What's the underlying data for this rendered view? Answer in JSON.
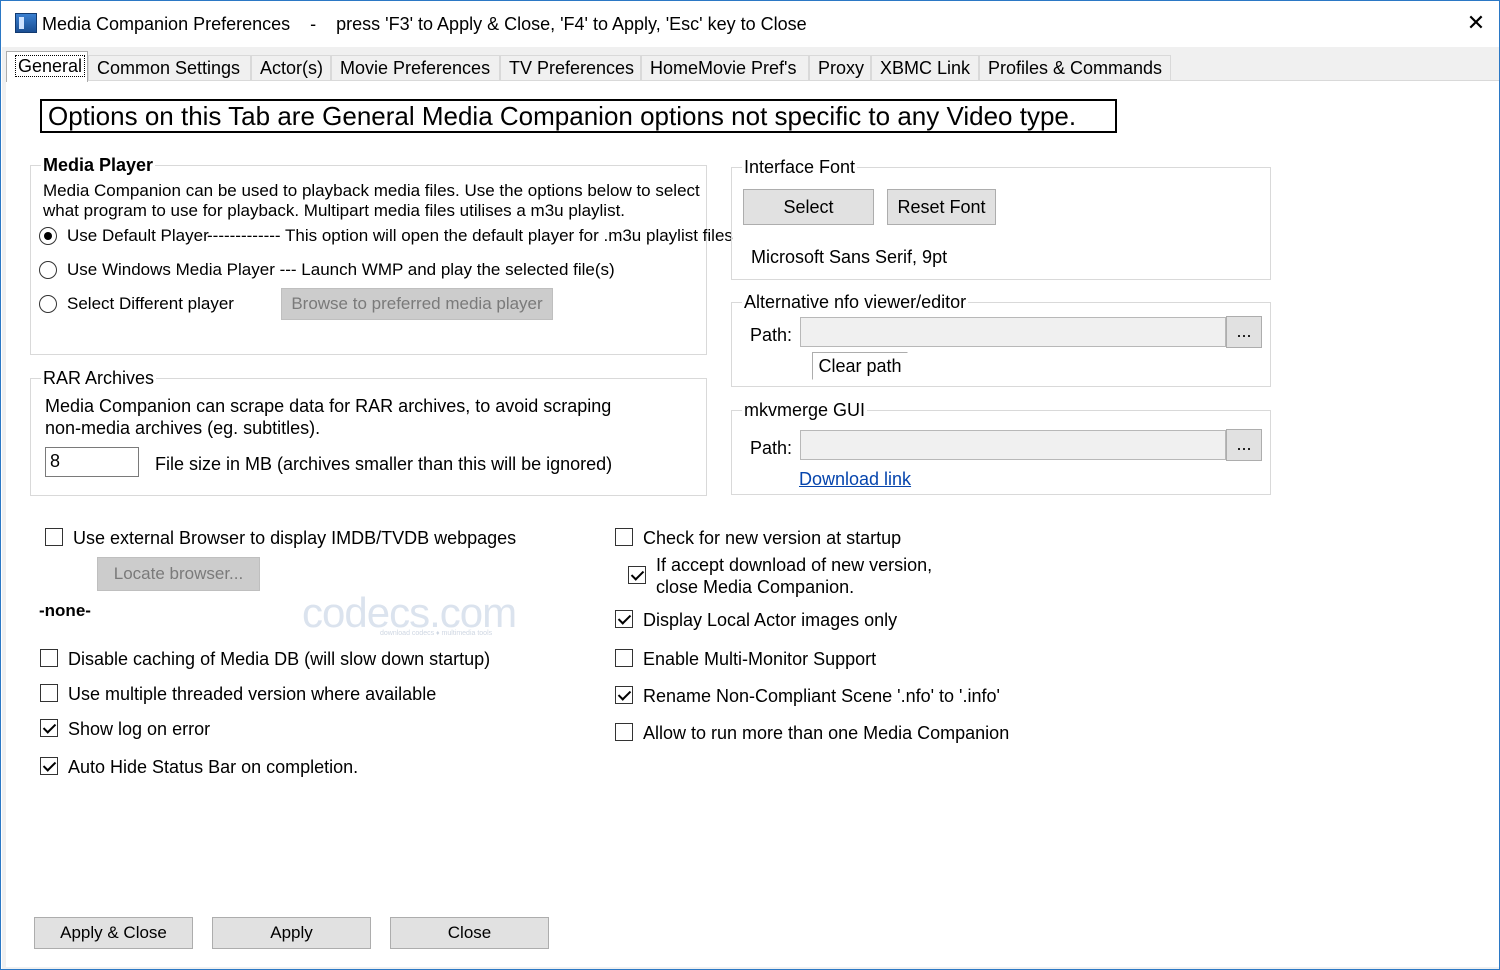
{
  "window": {
    "title": "Media Companion Preferences    -    press 'F3' to Apply & Close, 'F4' to Apply, 'Esc' key to Close",
    "close_glyph": "✕"
  },
  "tabs": [
    {
      "label": "General",
      "active": true
    },
    {
      "label": "Common Settings"
    },
    {
      "label": "Actor(s)"
    },
    {
      "label": "Movie Preferences"
    },
    {
      "label": "TV Preferences"
    },
    {
      "label": "HomeMovie Pref's"
    },
    {
      "label": "Proxy"
    },
    {
      "label": "XBMC Link"
    },
    {
      "label": "Profiles & Commands"
    }
  ],
  "banner": "Options on this Tab are General Media Companion options not specific to any Video type.",
  "media_player": {
    "title": "Media Player",
    "description_line1": "Media Companion can be used to playback media files.  Use the options below to select",
    "description_line2": "what program to use for playback.  Multipart media files utilises a m3u playlist.",
    "options": [
      {
        "label": "Use Default Player",
        "note": "-------------   This option will open the default player for .m3u playlist files",
        "checked": true
      },
      {
        "label": "Use Windows Media Player --- Launch WMP and play the selected file(s)",
        "checked": false
      },
      {
        "label": "Select Different player",
        "checked": false
      }
    ],
    "browse_button": "Browse to preferred media player"
  },
  "rar": {
    "title": "RAR Archives",
    "description_line1": "Media Companion can scrape data for RAR archives, to avoid scraping",
    "description_line2": "non-media archives (eg. subtitles).",
    "size_value": "8",
    "size_label": "File size in MB (archives smaller than this will be ignored)"
  },
  "interface_font": {
    "title": "Interface Font",
    "select_button": "Select",
    "reset_button": "Reset Font",
    "current_font": "Microsoft Sans Serif, 9pt"
  },
  "nfo_viewer": {
    "title": "Alternative nfo viewer/editor",
    "path_label": "Path:",
    "path_value": "",
    "browse_button": "...",
    "clear_button": "Clear path"
  },
  "mkvmerge": {
    "title": "mkvmerge GUI",
    "path_label": "Path:",
    "path_value": "",
    "browse_button": "...",
    "download_link": "Download link"
  },
  "left_options": {
    "external_browser": {
      "label": "Use external Browser to display IMDB/TVDB webpages",
      "checked": false
    },
    "locate_browser_button": "Locate browser...",
    "browser_path": "-none-",
    "disable_caching": {
      "label": "Disable caching of Media DB (will slow down startup)",
      "checked": false
    },
    "multithreaded": {
      "label": "Use multiple threaded version where available",
      "checked": false
    },
    "show_log": {
      "label": "Show log on error",
      "checked": true
    },
    "auto_hide": {
      "label": "Auto Hide Status Bar on completion.",
      "checked": true
    }
  },
  "right_options": {
    "check_version": {
      "label": "Check for new version at startup",
      "checked": false
    },
    "accept_download": {
      "label_line1": "If accept download of new version,",
      "label_line2": "close Media Companion.",
      "checked": true
    },
    "local_actor": {
      "label": "Display Local Actor images only",
      "checked": true
    },
    "multi_monitor": {
      "label": "Enable Multi-Monitor Support",
      "checked": false
    },
    "rename_nfo": {
      "label": "Rename Non-Compliant Scene '.nfo' to '.info'",
      "checked": true
    },
    "allow_multiple": {
      "label": "Allow to run more than one Media Companion",
      "checked": false
    }
  },
  "watermark": {
    "text": "codecs.com",
    "sub": "download codecs  ♦  multimedia tools"
  },
  "footer": {
    "apply_close": "Apply  &  Close",
    "apply": "Apply",
    "close": "Close"
  },
  "colors": {
    "accent": "#2b78c5",
    "link": "#0645ad",
    "surface": "#f0f0f0"
  }
}
